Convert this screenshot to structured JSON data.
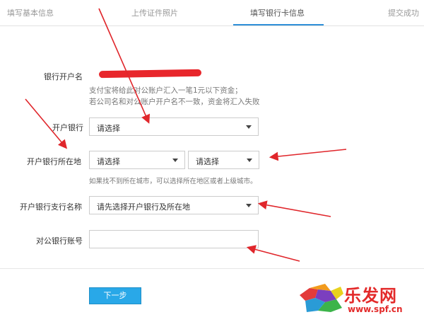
{
  "steps": [
    {
      "label": "填写基本信息",
      "active": false
    },
    {
      "label": "上传证件照片",
      "active": false
    },
    {
      "label": "填写银行卡信息",
      "active": true
    },
    {
      "label": "提交成功",
      "active": false
    }
  ],
  "form": {
    "account_name_label": "银行开户名",
    "account_name_hint_1": "支付宝将给此对公账户汇入一笔1元以下资金；",
    "account_name_hint_2": "若公司名和对公账户开户名不一致，资金将汇入失败",
    "bank_label": "开户银行",
    "bank_value": "请选择",
    "location_label": "开户银行所在地",
    "province_value": "请选择",
    "city_value": "请选择",
    "location_hint": "如果找不到所在城市，可以选择所在地区或者上级城市。",
    "branch_label": "开户银行支行名称",
    "branch_value": "请先选择开户银行及所在地",
    "account_number_label": "对公银行账号",
    "account_number_value": "",
    "next_label": "下一步"
  },
  "watermark": {
    "brand_text": "乐发网",
    "url": "www.spf.cn"
  },
  "colors": {
    "accent": "#2f8fd8",
    "button": "#29a8e8",
    "annotation_arrow": "#e0262b",
    "redaction": "#e8262b"
  }
}
